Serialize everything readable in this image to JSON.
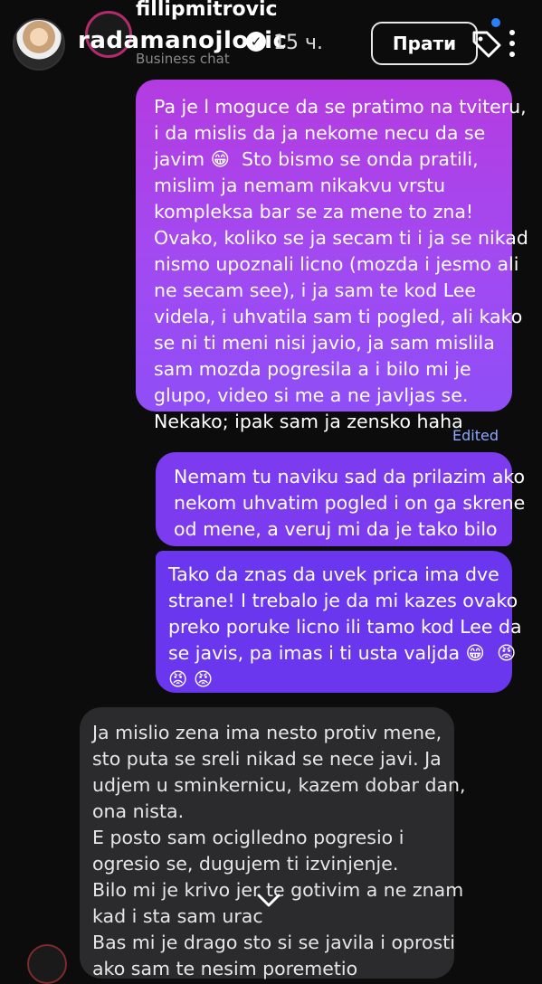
{
  "header": {
    "top_username": "fillipmitrovic",
    "username": "radamanojlovic",
    "time": "15 ч.",
    "subtitle": "Business chat",
    "follow_label": "Прати"
  },
  "messages": [
    {
      "sender": "me",
      "text": "Pa je l moguce da se pratimo na tviteru,\ni da mislis da ja nekome necu da se\njavim 😁  Sto bismo se onda pratili,\nmislim ja nemam nikakvu vrstu\nkompleksa bar se za mene to zna!\nOvako, koliko se ja secam ti i ja se nikad\nnismo upoznali licno (mozda i jesmo ali\nne secam see), i ja sam te kod Lee\nvidela, i uhvatila sam ti pogled, ali kako\nse ni ti meni nisi javio, ja sam mislila\nsam mozda pogresila a i bilo mi je\nglupo, video si me a ne javljas se.\nNekako; ipak sam ja zensko haha",
      "edited": "Edited"
    },
    {
      "sender": "me",
      "text": "Nemam tu naviku sad da prilazim ako\nnekom uhvatim pogled i on ga skrene\nod mene, a veruj mi da je tako bilo"
    },
    {
      "sender": "me",
      "text": "Tako da znas da uvek prica ima dve\nstrane! I trebalo je da mi kazes ovako\npreko poruke licno ili tamo kod Lee da\nse javis, pa imas i ti usta valjda 😁  😡\n😡 😡"
    },
    {
      "sender": "them",
      "text": "Ja mislio zena ima nesto protiv mene,\nsto puta se sreli nikad se nece javi. Ja\nudjem u sminkernicu, kazem dobar dan,\nona nista.\nE posto sam ociglledno pogresio i\nogresio se, dugujem ti izvinjenje.\nBilo mi je krivo jer te gotivim a ne znam\nkad i sta sam urac\nBas mi je drago sto si se javila i oprosti\nako sam te nesim poremetio"
    }
  ]
}
